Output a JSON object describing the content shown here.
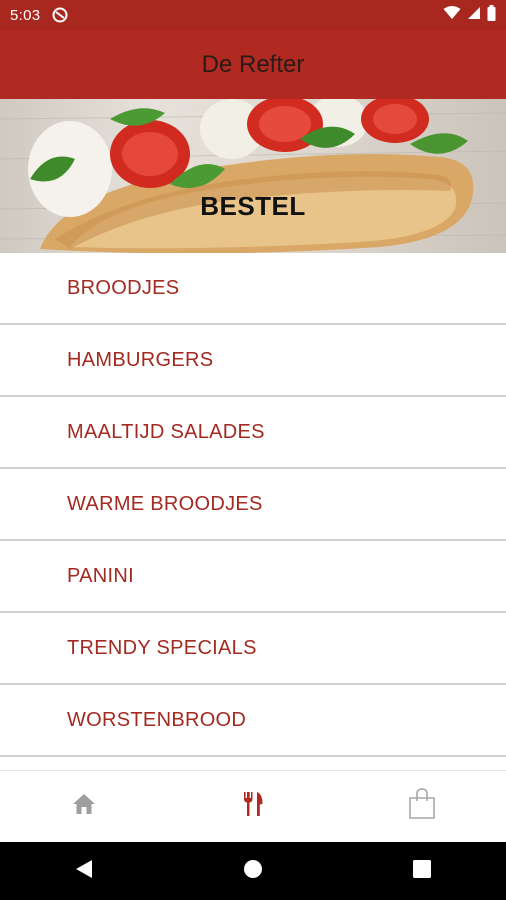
{
  "status_bar": {
    "time": "5:03",
    "icons": [
      "data-saver-icon",
      "wifi-icon",
      "signal-icon",
      "battery-icon"
    ]
  },
  "app_bar": {
    "title": "De Refter"
  },
  "hero": {
    "title": "BESTEL",
    "image": "sandwich-banner-image"
  },
  "menu": {
    "items": [
      {
        "label": "BROODJES"
      },
      {
        "label": "HAMBURGERS"
      },
      {
        "label": "MAALTIJD SALADES"
      },
      {
        "label": "WARME BROODJES"
      },
      {
        "label": "PANINI"
      },
      {
        "label": "TRENDY SPECIALS"
      },
      {
        "label": "WORSTENBROOD"
      }
    ]
  },
  "bottom_nav": {
    "items": [
      {
        "icon": "home-icon",
        "active": false
      },
      {
        "icon": "fork-knife-icon",
        "active": true
      },
      {
        "icon": "shopping-bag-icon",
        "active": false
      }
    ]
  },
  "system_nav": {
    "icons": [
      "back-icon",
      "home-circle-icon",
      "recents-icon"
    ]
  },
  "colors": {
    "primary": "#b02a22",
    "status_bar": "#a8281f",
    "menu_text": "#a32a20",
    "divider": "#cfcfcf",
    "nav_inactive": "#9e9e9e"
  }
}
